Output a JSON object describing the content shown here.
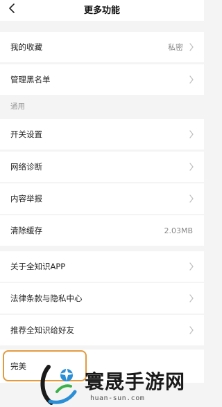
{
  "header": {
    "title": "更多功能"
  },
  "rows": {
    "favorites": {
      "label": "我的收藏",
      "value": "私密"
    },
    "blacklist": {
      "label": "管理黑名单"
    },
    "switch_settings": {
      "label": "开关设置"
    },
    "network": {
      "label": "网络诊断"
    },
    "report": {
      "label": "内容举报"
    },
    "cache": {
      "label": "清除缓存",
      "value": "2.03MB"
    },
    "about": {
      "label": "关于全知识APP"
    },
    "legal": {
      "label": "法律条款与隐私中心"
    },
    "recommend": {
      "label": "推荐全知识给好友"
    },
    "complete": {
      "label": "完美"
    }
  },
  "section": {
    "general": "通用"
  },
  "watermark": {
    "title": "寰晟手游网",
    "url": "huan-sun.com"
  },
  "colors": {
    "highlight": "#e39a3d",
    "background": "#f4f4f4",
    "chevron": "#c0c0c0"
  }
}
